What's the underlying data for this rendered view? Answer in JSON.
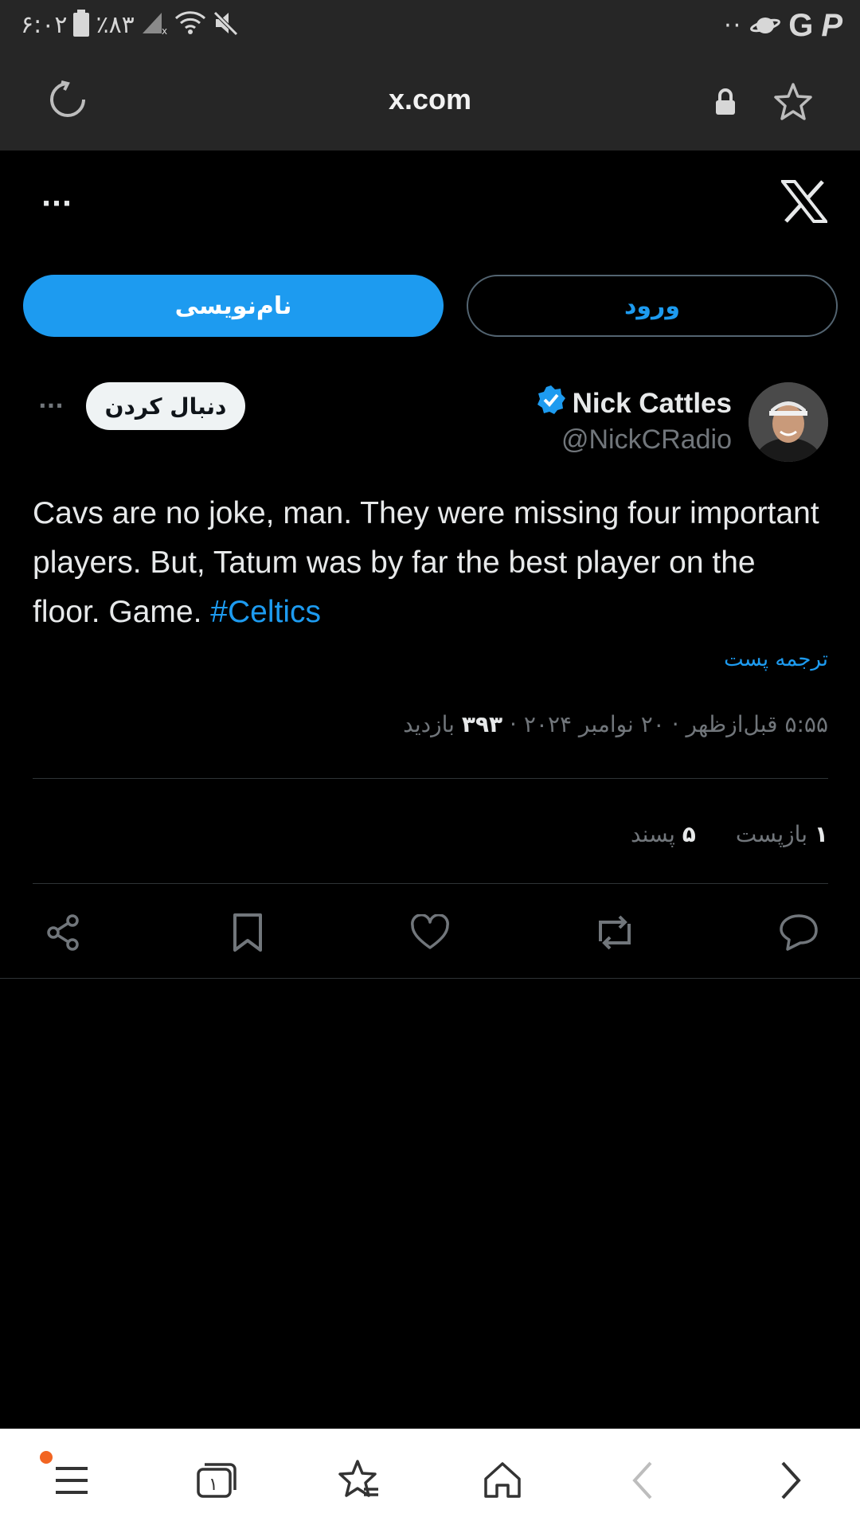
{
  "status_bar": {
    "time": "۶:۰۲",
    "battery_pct": "٪۸۳",
    "overflow": "··"
  },
  "browser": {
    "url": "x.com"
  },
  "header": {
    "more_label": "···"
  },
  "auth": {
    "signup_label": "نام‌نویسی",
    "login_label": "ورود"
  },
  "post": {
    "display_name": "Nick Cattles",
    "handle": "@NickCRadio",
    "follow_label": "دنبال کردن",
    "more_label": "···",
    "text": "Cavs are no joke, man. They were missing four important players. But, Tatum was by far the best player on the floor. Game.",
    "hashtag": "#Celtics",
    "translate_label": "ترجمه پست",
    "time": "۵:۵۵ قبل‌ازظهر",
    "date": "۲۰ نوامبر ۲۰۲۴",
    "views_count": "۳۹۳",
    "views_label": "بازدید",
    "separator": "·",
    "reposts_count": "۱",
    "reposts_label": "بازپست",
    "likes_count": "۵",
    "likes_label": "پسند"
  },
  "icons": {
    "reload": "reload-icon",
    "lock": "lock-icon",
    "bookmark_star": "star-icon",
    "x_logo": "x-logo-icon",
    "verified": "verified-badge-icon",
    "reply": "reply-icon",
    "repost": "repost-icon",
    "like": "heart-icon",
    "bookmark": "bookmark-icon",
    "share": "share-icon"
  },
  "colors": {
    "accent": "#1d9bf0",
    "background": "#000000",
    "chrome": "#262626",
    "notification_dot": "#f26522"
  }
}
